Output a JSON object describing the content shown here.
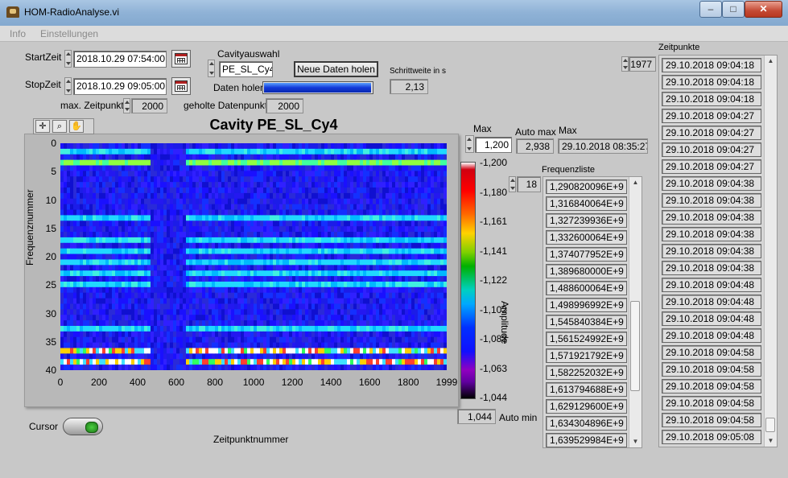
{
  "window": {
    "title": "HOM-RadioAnalyse.vi",
    "minimize": "–",
    "maximize": "□",
    "close": "✕"
  },
  "menu": {
    "items": [
      "Info",
      "Einstellungen"
    ]
  },
  "controls": {
    "start_label": "StartZeit",
    "start_value": "2018.10.29 07:54:00",
    "stop_label": "StopZeit",
    "stop_value": "2018.10.29 09:05:00",
    "max_zeitpunkte_label": "max. Zeitpunkte",
    "max_zeitpunkte_value": "2000",
    "cavity_label": "Cavityauswahl",
    "cavity_value": "PE_SL_Cy4",
    "daten_holen_label": "Daten holen",
    "progress": 0.98,
    "neue_daten_button": "Neue Daten holen",
    "geholte_label": "geholte Datenpunkte",
    "geholte_value": "2000",
    "schrittweite_label": "Schrittweite in s",
    "schrittweite_value": "2,13"
  },
  "scale": {
    "max_label": "Max",
    "max_value": "1,200",
    "auto_max_label": "Auto max",
    "auto_max_value": "2,938",
    "max_time_label": "Max",
    "max_time_value": "29.10.2018 08:35:27",
    "min_value": "1,044",
    "auto_min_label": "Auto min",
    "axis_label": "Amplitude",
    "ticks": [
      "-1,200",
      "-1,180",
      "-1,161",
      "-1,141",
      "-1,122",
      "-1,102",
      "-1,083",
      "-1,063",
      "-1,044"
    ]
  },
  "chart_data": {
    "type": "heatmap",
    "title": "Cavity PE_SL_Cy4",
    "xlabel": "Zeitpunktnummer",
    "ylabel": "Frequenznummer",
    "xlim": [
      0,
      1999
    ],
    "ylim": [
      40,
      0
    ],
    "x_ticks": [
      "0",
      "200",
      "400",
      "600",
      "800",
      "1000",
      "1200",
      "1400",
      "1600",
      "1800",
      "1999"
    ],
    "y_ticks": [
      "0",
      "5",
      "10",
      "15",
      "20",
      "25",
      "30",
      "35",
      "40"
    ],
    "colorbar_label": "Amplitude",
    "bright_rows": [
      1,
      3,
      13,
      17,
      19,
      21,
      23,
      25,
      33,
      37,
      39
    ],
    "dark_time_range": [
      470,
      650
    ]
  },
  "frequenzliste": {
    "label": "Frequenzliste",
    "index": "18",
    "items": [
      "1,290820096E+9",
      "1,316840064E+9",
      "1,327239936E+9",
      "1,332600064E+9",
      "1,374077952E+9",
      "1,389680000E+9",
      "1,488600064E+9",
      "1,498996992E+9",
      "1,545840384E+9",
      "1,561524992E+9",
      "1,571921792E+9",
      "1,582252032E+9",
      "1,613794688E+9",
      "1,629129600E+9",
      "1,634304896E+9",
      "1,639529984E+9"
    ]
  },
  "zeitpunkte": {
    "label": "Zeitpunkte",
    "index": "1977",
    "items": [
      "29.10.2018 09:04:18",
      "29.10.2018 09:04:18",
      "29.10.2018 09:04:18",
      "29.10.2018 09:04:27",
      "29.10.2018 09:04:27",
      "29.10.2018 09:04:27",
      "29.10.2018 09:04:27",
      "29.10.2018 09:04:38",
      "29.10.2018 09:04:38",
      "29.10.2018 09:04:38",
      "29.10.2018 09:04:38",
      "29.10.2018 09:04:38",
      "29.10.2018 09:04:38",
      "29.10.2018 09:04:48",
      "29.10.2018 09:04:48",
      "29.10.2018 09:04:48",
      "29.10.2018 09:04:48",
      "29.10.2018 09:04:58",
      "29.10.2018 09:04:58",
      "29.10.2018 09:04:58",
      "29.10.2018 09:04:58",
      "29.10.2018 09:04:58",
      "29.10.2018 09:05:08"
    ]
  },
  "cursor": {
    "label": "Cursor"
  }
}
